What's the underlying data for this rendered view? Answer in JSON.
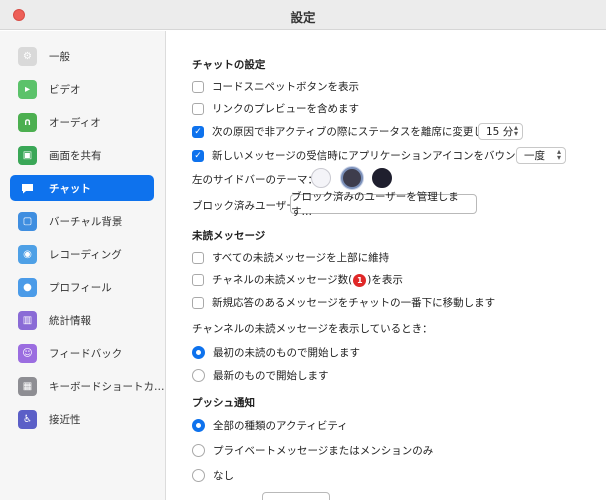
{
  "window": {
    "title": "設定"
  },
  "sidebar": {
    "items": [
      {
        "label": "一般",
        "icon": "gear-icon",
        "color": "#d9d9d9"
      },
      {
        "label": "ビデオ",
        "icon": "video-camera-icon",
        "color": "#5bc26a"
      },
      {
        "label": "オーディオ",
        "icon": "headphones-icon",
        "color": "#4caf50"
      },
      {
        "label": "画面を共有",
        "icon": "share-screen-icon",
        "color": "#3aa757"
      },
      {
        "label": "チャット",
        "icon": "chat-bubble-icon",
        "color": "#0e72ed",
        "active": true
      },
      {
        "label": "バーチャル背景",
        "icon": "person-background-icon",
        "color": "#3f8ee0"
      },
      {
        "label": "レコーディング",
        "icon": "record-icon",
        "color": "#4ea0e6"
      },
      {
        "label": "プロフィール",
        "icon": "profile-icon",
        "color": "#4b9be8"
      },
      {
        "label": "統計情報",
        "icon": "statistics-icon",
        "color": "#8a6bd6"
      },
      {
        "label": "フィードバック",
        "icon": "smiley-icon",
        "color": "#9b6de0"
      },
      {
        "label": "キーボードショートカ…",
        "icon": "keyboard-icon",
        "color": "#8e8e93"
      },
      {
        "label": "接近性",
        "icon": "accessibility-icon",
        "color": "#5b5fc7"
      }
    ]
  },
  "chat": {
    "title": "チャットの設定",
    "code_snippet": "コードスニペットボタンを表示",
    "link_preview": "リンクのプレビューを含めます",
    "inactive_status": "次の原因で非アクティブの際にステータスを離席に変更します:",
    "inactive_select": "15 分",
    "new_message_bounce": "新しいメッセージの受信時にアプリケーションアイコンをバウンスします",
    "bounce_select": "一度",
    "theme_label": "左のサイドバーのテーマ：",
    "blocked_label": "ブロック済みユーザー",
    "blocked_button": "ブロック済みのユーザーを管理します…"
  },
  "unread": {
    "title": "未読メッセージ",
    "keep_top": "すべての未読メッセージを上部に維持",
    "channel_count_prefix": "チャネルの未読メッセージ数(",
    "channel_count_badge": "1",
    "channel_count_suffix": ")を表示",
    "move_new_replies": "新規応答のあるメッセージをチャットの一番下に移動します",
    "when_showing": "チャンネルの未読メッセージを表示しているとき：",
    "start_oldest": "最初の未読のもので開始します",
    "start_newest": "最新のもので開始します"
  },
  "push": {
    "title": "プッシュ通知",
    "all_activity": "全部の種類のアクティビティ",
    "private_mentions": "プライベートメッセージまたはメンションのみ",
    "none": "なし"
  },
  "colors": {
    "accent": "#0e72ed",
    "badge": "#e02828",
    "close_button": "#ed5f57"
  }
}
